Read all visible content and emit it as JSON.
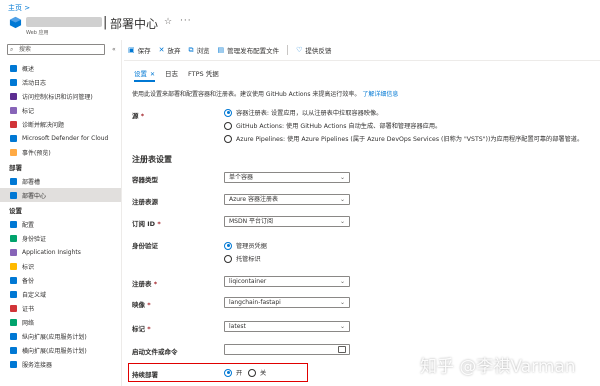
{
  "breadcrumb": "主页 >",
  "header": {
    "title": "部署中心",
    "subtitle": "Web 应用"
  },
  "sidebar": {
    "search_placeholder": "搜索",
    "items": [
      {
        "label": "概述",
        "color": "#0078d4"
      },
      {
        "label": "活动日志",
        "color": "#0078d4"
      },
      {
        "label": "访问控制(标识和访问管理)",
        "color": "#5c2d91"
      },
      {
        "label": "标记",
        "color": "#8764b8"
      },
      {
        "label": "诊断并解决问题",
        "color": "#d13438"
      },
      {
        "label": "Microsoft Defender for Cloud",
        "color": "#0078d4"
      },
      {
        "label": "事件(预览)",
        "color": "#ffaa44"
      }
    ],
    "section_deploy": "部署",
    "deploy_items": [
      {
        "label": "部署槽",
        "color": "#0078d4"
      },
      {
        "label": "部署中心",
        "color": "#0078d4"
      }
    ],
    "section_settings": "设置",
    "settings_items": [
      {
        "label": "配置",
        "color": "#0078d4"
      },
      {
        "label": "身份验证",
        "color": "#00a36c"
      },
      {
        "label": "Application Insights",
        "color": "#8764b8"
      },
      {
        "label": "标识",
        "color": "#ffb900"
      },
      {
        "label": "备份",
        "color": "#0078d4"
      },
      {
        "label": "自定义域",
        "color": "#0078d4"
      },
      {
        "label": "证书",
        "color": "#d13438"
      },
      {
        "label": "网络",
        "color": "#00a36c"
      },
      {
        "label": "纵向扩展(应用服务计划)",
        "color": "#0078d4"
      },
      {
        "label": "横向扩展(应用服务计划)",
        "color": "#0078d4"
      },
      {
        "label": "服务连接器",
        "color": "#0078d4"
      }
    ]
  },
  "toolbar": {
    "save": "保存",
    "discard": "放弃",
    "browse": "浏览",
    "manage_profile": "管理发布配置文件",
    "feedback": "提供反馈"
  },
  "tabs": {
    "settings": "设置",
    "logs": "日志",
    "ftps": "FTPS 凭据"
  },
  "intro": {
    "text": "使用此设置来部署和配置容器和注册表。建议使用 GitHub Actions 来提高运行效率。",
    "link": "了解详细信息"
  },
  "source": {
    "label": "源",
    "options": [
      {
        "label": "容器注册表: 设置应用，以从注册表中拉取容器映像。",
        "checked": true
      },
      {
        "label": "GitHub Actions: 使用 GitHub Actions 自动生成、部署和管理容器应用。",
        "checked": false
      },
      {
        "label": "Azure Pipelines: 使用 Azure Pipelines (属于 Azure DevOps Services (旧称为 \"VSTS\"))为应用程序配置可靠的部署管道。",
        "checked": false
      }
    ]
  },
  "registry_settings": {
    "title": "注册表设置",
    "container_type": {
      "label": "容器类型",
      "value": "单个容器"
    },
    "registry_source": {
      "label": "注册表源",
      "value": "Azure 容器注册表"
    },
    "subscription": {
      "label": "订阅 ID",
      "value": "MSDN 平台订阅"
    },
    "auth": {
      "label": "身份验证",
      "options": [
        {
          "label": "管理员凭据",
          "checked": true
        },
        {
          "label": "托管标识",
          "checked": false
        }
      ]
    },
    "registry": {
      "label": "注册表",
      "value": "liqicontainer"
    },
    "image": {
      "label": "映像",
      "value": "langchain-fastapi"
    },
    "tag": {
      "label": "标记",
      "value": "latest"
    },
    "startup": {
      "label": "启动文件或命令",
      "value": ""
    },
    "cd": {
      "label": "持续部署",
      "on": "开",
      "off": "关",
      "on_checked": true
    }
  },
  "watermark": "知乎 @李祺Varman"
}
